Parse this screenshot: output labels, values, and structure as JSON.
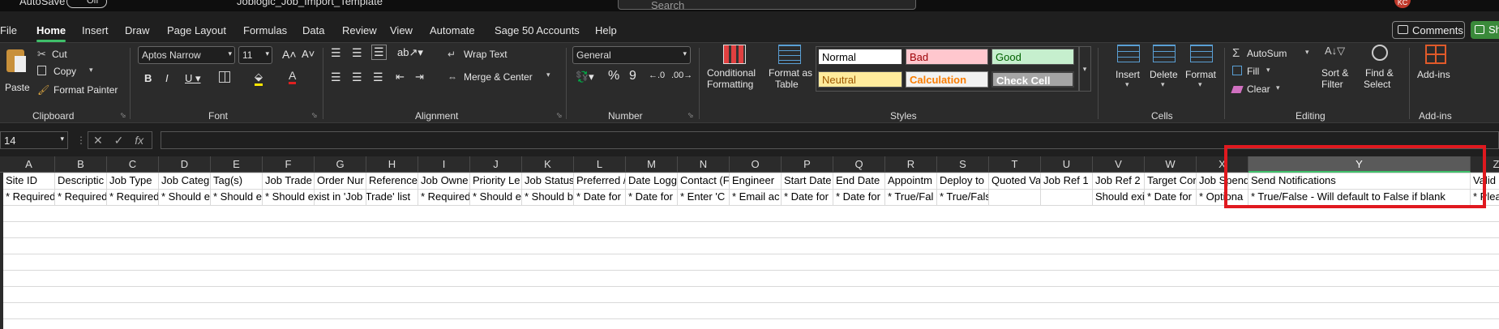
{
  "title_bar": {
    "autosave": "AutoSave",
    "autosave_state": "Off",
    "filename": "Joblogic_Job_Import_Template",
    "search_placeholder": "Search",
    "avatar_initials": "KC"
  },
  "menu": {
    "tabs": [
      "File",
      "Home",
      "Insert",
      "Draw",
      "Page Layout",
      "Formulas",
      "Data",
      "Review",
      "View",
      "Automate",
      "Sage 50 Accounts",
      "Help"
    ],
    "active": "Home",
    "comments": "Comments",
    "share": "Sh"
  },
  "ribbon": {
    "clipboard": {
      "paste": "Paste",
      "cut": "Cut",
      "copy": "Copy",
      "format_painter": "Format Painter",
      "group": "Clipboard"
    },
    "font": {
      "name": "Aptos Narrow",
      "size": "11",
      "group": "Font"
    },
    "alignment": {
      "wrap_text": "Wrap Text",
      "merge_center": "Merge & Center",
      "group": "Alignment"
    },
    "number": {
      "format": "General",
      "group": "Number"
    },
    "styles": {
      "conditional": "Conditional",
      "conditional2": "Formatting",
      "format_as": "Format as",
      "format_as2": "Table",
      "normal": "Normal",
      "bad": "Bad",
      "good": "Good",
      "neutral": "Neutral",
      "calculation": "Calculation",
      "check_cell": "Check Cell",
      "group": "Styles"
    },
    "cells": {
      "insert": "Insert",
      "delete": "Delete",
      "format": "Format",
      "group": "Cells"
    },
    "editing": {
      "autosum": "AutoSum",
      "fill": "Fill",
      "clear": "Clear",
      "sort_filter": "Sort &",
      "sort_filter2": "Filter",
      "find_select": "Find &",
      "find_select2": "Select",
      "group": "Editing"
    },
    "addins": {
      "label": "Add-ins",
      "group": "Add-ins"
    }
  },
  "formula_bar": {
    "name_box": "14",
    "fx": "fx"
  },
  "columns": [
    "A",
    "B",
    "C",
    "D",
    "E",
    "F",
    "G",
    "H",
    "I",
    "J",
    "K",
    "L",
    "M",
    "N",
    "O",
    "P",
    "Q",
    "R",
    "S",
    "T",
    "U",
    "V",
    "W",
    "X",
    "Y",
    "Z"
  ],
  "selected_column": "Y",
  "row1": [
    "Site ID",
    "Descriptic",
    "Job Type",
    "Job Categ",
    "Tag(s)",
    "Job Trade",
    "Order Nur",
    "Reference",
    "Job Owne",
    "Priority Le",
    "Job Status",
    "Preferred /",
    "Date Logge",
    "Contact (F",
    "Engineer",
    "Start Date",
    "End Date",
    "Appointm",
    "Deploy to",
    "Quoted Va",
    "Job Ref 1",
    "Job Ref 2",
    "Target Cor",
    "Job Spend",
    "Send Notifications",
    "Valid"
  ],
  "row2": [
    "* Required",
    "* Required",
    "* Required",
    "* Should e",
    "* Should e",
    "* Should exist in 'Job Trade' list",
    "",
    "",
    "* Required",
    "* Should e",
    "* Should b",
    "* Date for",
    "* Date for",
    "* Enter  'C",
    "* Email ac",
    "* Date for",
    "* Date for",
    "* True/Fal",
    "* True/False - Will default to Fa",
    "",
    "",
    "Should exi",
    "* Date for",
    "* Optiona",
    "* True/False - Will default to False if blank",
    "* Plea"
  ],
  "colors": {
    "highlight": "#e0191f",
    "accent_green": "#3fbf6a"
  }
}
